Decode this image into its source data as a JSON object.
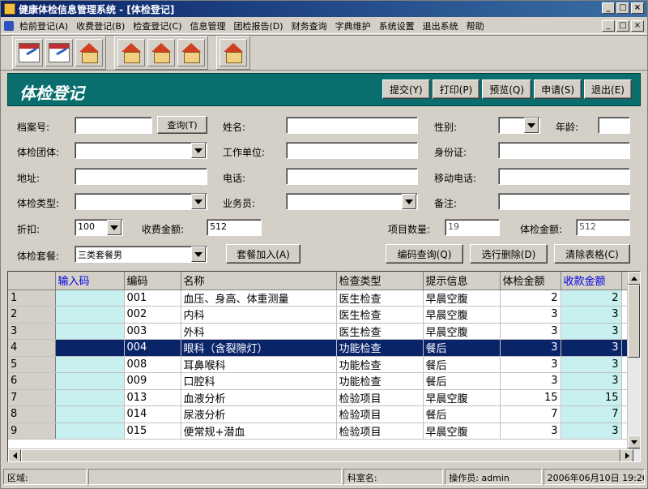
{
  "window": {
    "title": "健康体检信息管理系统 - [体检登记]",
    "controls": [
      "_",
      "□",
      "×"
    ],
    "mdi_controls": [
      "_",
      "□",
      "×"
    ]
  },
  "menu": {
    "items": [
      "检前登记(A)",
      "收费登记(B)",
      "检查登记(C)",
      "信息管理",
      "团检报告(D)",
      "财务查询",
      "字典维护",
      "系统设置",
      "退出系统",
      "帮助"
    ]
  },
  "toolbar": {
    "group1_icons": [
      "calendar-edit-icon",
      "calendar-edit-icon",
      "house-icon"
    ],
    "group2_icons": [
      "house-icon",
      "house-money-icon",
      "house-search-icon"
    ],
    "group3_icons": [
      "house-exit-icon"
    ]
  },
  "header": {
    "title": "体检登记",
    "buttons": [
      "提交(Y)",
      "打印(P)",
      "预览(Q)",
      "申请(S)",
      "退出(E)"
    ]
  },
  "form": {
    "archive_no_label": "档案号:",
    "query_button": "查询(T)",
    "name_label": "姓名:",
    "gender_label": "性别:",
    "age_label": "年龄:",
    "group_label": "体检团体:",
    "work_unit_label": "工作单位:",
    "id_card_label": "身份证:",
    "address_label": "地址:",
    "phone_label": "电话:",
    "mobile_label": "移动电话:",
    "exam_type_label": "体检类型:",
    "salesman_label": "业务员:",
    "remark_label": "备注:",
    "discount_label": "折扣:",
    "discount_value": "100",
    "fee_label": "收费金额:",
    "fee_value": "512",
    "item_count_label": "项目数量:",
    "item_count_value": "19",
    "exam_amount_label": "体检金额:",
    "exam_amount_value": "512",
    "package_label": "体检套餐:",
    "package_value": "三类套餐男",
    "add_package_button": "套餐加入(A)",
    "code_query_button": "编码查询(Q)",
    "delete_row_button": "选行删除(D)",
    "clear_table_button": "清除表格(C)"
  },
  "grid": {
    "columns": [
      "输入码",
      "编码",
      "名称",
      "检查类型",
      "提示信息",
      "体检金额",
      "收款金额"
    ],
    "rows": [
      {
        "n": "1",
        "code": "001",
        "name": "血压、身高、体重测量",
        "type": "医生检查",
        "tip": "早晨空腹",
        "amount": "2",
        "paid": "2"
      },
      {
        "n": "2",
        "code": "002",
        "name": "内科",
        "type": "医生检查",
        "tip": "早晨空腹",
        "amount": "3",
        "paid": "3"
      },
      {
        "n": "3",
        "code": "003",
        "name": "外科",
        "type": "医生检查",
        "tip": "早晨空腹",
        "amount": "3",
        "paid": "3"
      },
      {
        "n": "4",
        "code": "004",
        "name": "眼科（含裂隙灯）",
        "type": "功能检查",
        "tip": "餐后",
        "amount": "3",
        "paid": "3"
      },
      {
        "n": "5",
        "code": "008",
        "name": "耳鼻喉科",
        "type": "功能检查",
        "tip": "餐后",
        "amount": "3",
        "paid": "3"
      },
      {
        "n": "6",
        "code": "009",
        "name": "口腔科",
        "type": "功能检查",
        "tip": "餐后",
        "amount": "3",
        "paid": "3"
      },
      {
        "n": "7",
        "code": "013",
        "name": "血液分析",
        "type": "检验项目",
        "tip": "早晨空腹",
        "amount": "15",
        "paid": "15"
      },
      {
        "n": "8",
        "code": "014",
        "name": "尿液分析",
        "type": "检验项目",
        "tip": "餐后",
        "amount": "7",
        "paid": "7"
      },
      {
        "n": "9",
        "code": "015",
        "name": "便常规+潜血",
        "type": "检验项目",
        "tip": "早晨空腹",
        "amount": "3",
        "paid": "3"
      }
    ]
  },
  "status": {
    "area_label": "区域:",
    "dept_label": "科室名:",
    "operator": "操作员: admin",
    "datetime": "2006年06月10日 19:26"
  }
}
